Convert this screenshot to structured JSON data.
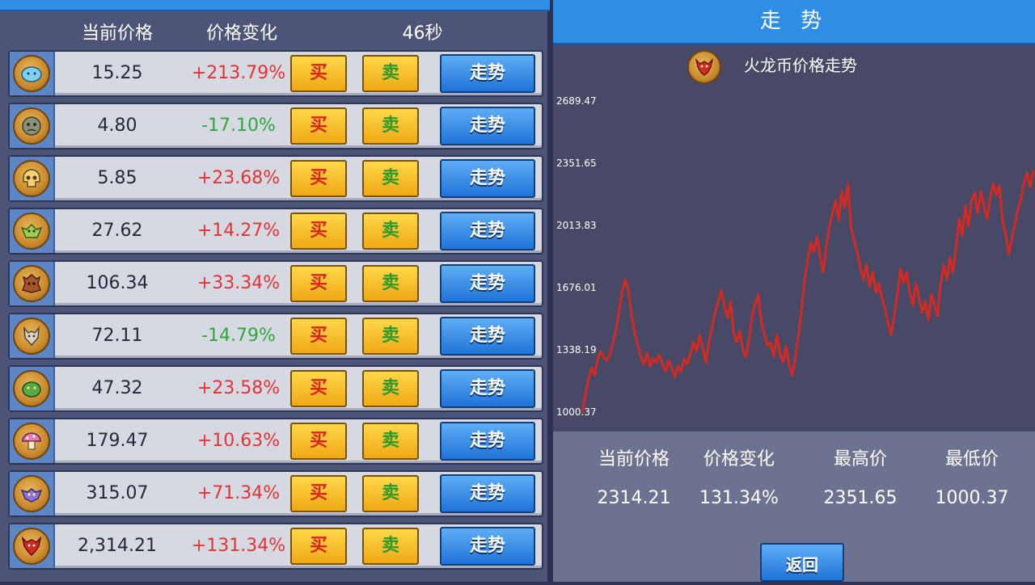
{
  "market": {
    "headers": {
      "price": "当前价格",
      "change": "价格变化",
      "timer": "46秒"
    },
    "buttons": {
      "buy": "买",
      "sell": "卖",
      "trend": "走势"
    },
    "coins": [
      {
        "icon": "blue-slime-icon",
        "price": "15.25",
        "change": "+213.79%",
        "trend": "up"
      },
      {
        "icon": "zombie-face-icon",
        "price": "4.80",
        "change": "-17.10%",
        "trend": "down"
      },
      {
        "icon": "skull-icon",
        "price": "5.85",
        "change": "+23.68%",
        "trend": "up"
      },
      {
        "icon": "goblin-icon",
        "price": "27.62",
        "change": "+14.27%",
        "trend": "up"
      },
      {
        "icon": "tree-monster-icon",
        "price": "106.34",
        "change": "+33.34%",
        "trend": "up"
      },
      {
        "icon": "wolf-icon",
        "price": "72.11",
        "change": "-14.79%",
        "trend": "down"
      },
      {
        "icon": "green-orc-icon",
        "price": "47.32",
        "change": "+23.58%",
        "trend": "up"
      },
      {
        "icon": "mushroom-icon",
        "price": "179.47",
        "change": "+10.63%",
        "trend": "up"
      },
      {
        "icon": "purple-bat-icon",
        "price": "315.07",
        "change": "+71.34%",
        "trend": "up"
      },
      {
        "icon": "red-dragon-icon",
        "price": "2,314.21",
        "change": "+131.34%",
        "trend": "up"
      }
    ]
  },
  "trend_panel": {
    "title": "走 势",
    "chart_title": "火龙币价格走势",
    "chart_icon": "red-dragon-icon",
    "stats": {
      "labels": [
        "当前价格",
        "价格变化",
        "最高价",
        "最低价"
      ],
      "values": [
        "2314.21",
        "131.34%",
        "2351.65",
        "1000.37"
      ]
    },
    "back_label": "返回"
  },
  "colors": {
    "line": "#d42a22",
    "positive": "#e23434",
    "negative": "#2ea83d",
    "accent_blue": "#2f8de4"
  },
  "chart_data": {
    "type": "line",
    "title": "火龙币价格走势",
    "yticks": [
      "2689.47",
      "2351.65",
      "2013.83",
      "1676.01",
      "1338.19",
      "1000.37"
    ],
    "ylim": [
      1000.37,
      2689.47
    ],
    "grid": false,
    "series": [
      {
        "values": [
          1000,
          1090,
          1180,
          1240,
          1200,
          1290,
          1330,
          1300,
          1280,
          1320,
          1380,
          1450,
          1560,
          1660,
          1720,
          1650,
          1520,
          1430,
          1360,
          1300,
          1260,
          1320,
          1250,
          1290,
          1270,
          1310,
          1260,
          1220,
          1280,
          1240,
          1190,
          1250,
          1220,
          1290,
          1260,
          1320,
          1380,
          1330,
          1420,
          1350,
          1270,
          1380,
          1460,
          1540,
          1600,
          1660,
          1580,
          1510,
          1600,
          1430,
          1380,
          1440,
          1340,
          1300,
          1400,
          1520,
          1590,
          1640,
          1480,
          1420,
          1360,
          1380,
          1300,
          1420,
          1320,
          1270,
          1360,
          1250,
          1200,
          1300,
          1420,
          1560,
          1720,
          1830,
          1920,
          1870,
          1950,
          1840,
          1760,
          1900,
          2010,
          2080,
          2150,
          2040,
          2200,
          2110,
          2240,
          2000,
          1930,
          1870,
          1780,
          1720,
          1800,
          1680,
          1760,
          1650,
          1700,
          1620,
          1560,
          1480,
          1420,
          1530,
          1640,
          1780,
          1700,
          1760,
          1650,
          1580,
          1700,
          1620,
          1540,
          1600,
          1500,
          1640,
          1580,
          1520,
          1700,
          1800,
          1720,
          1840,
          1760,
          1900,
          2050,
          1960,
          2120,
          2010,
          2150,
          2190,
          2080,
          2200,
          2120,
          2050,
          2160,
          2240,
          2180,
          2230,
          2040,
          1970,
          1860,
          1940,
          2020,
          2100,
          2160,
          2250,
          2300,
          2220,
          2314
        ]
      }
    ]
  }
}
